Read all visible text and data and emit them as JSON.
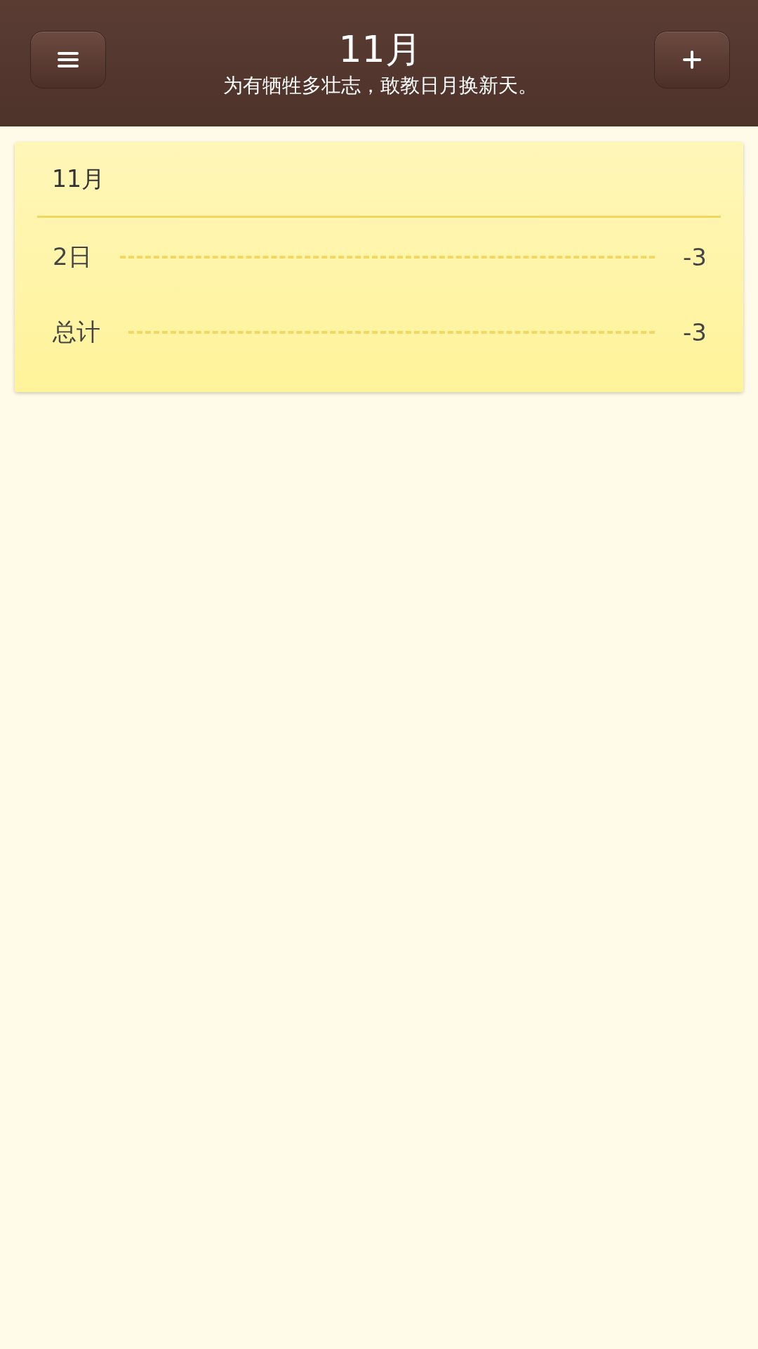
{
  "header": {
    "title": "11月",
    "subtitle": "为有牺牲多壮志，敢教日月换新天。"
  },
  "card": {
    "title": "11月",
    "rows": [
      {
        "label": "2日",
        "value": "-3"
      },
      {
        "label": "总计",
        "value": "-3"
      }
    ]
  }
}
